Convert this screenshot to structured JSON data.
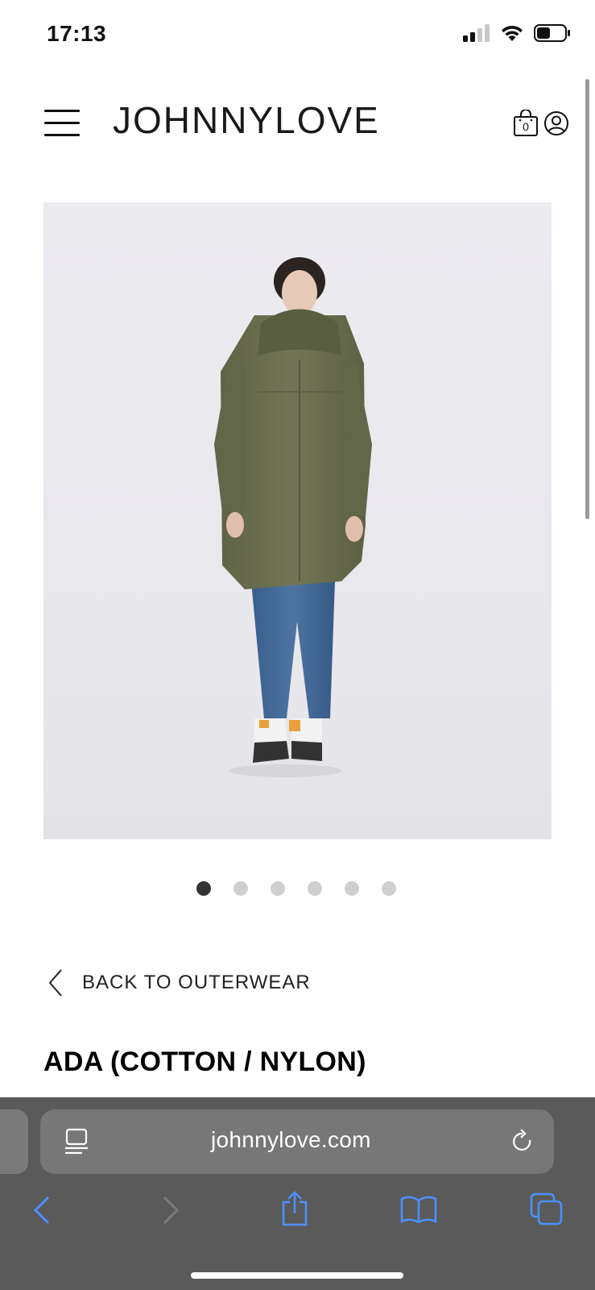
{
  "status": {
    "time": "17:13"
  },
  "header": {
    "brand": "JOHNNYLOVE",
    "cart_count": "0"
  },
  "carousel": {
    "total": 6,
    "active": 1
  },
  "nav": {
    "back_label": "BACK TO OUTERWEAR"
  },
  "product": {
    "title": "ADA (COTTON / NYLON)"
  },
  "browser": {
    "url": "johnnylove.com"
  },
  "colors": {
    "accent_blue": "#4a90ff",
    "browser_bar": "#5a5a5a",
    "coat_olive": "#6e7150"
  }
}
